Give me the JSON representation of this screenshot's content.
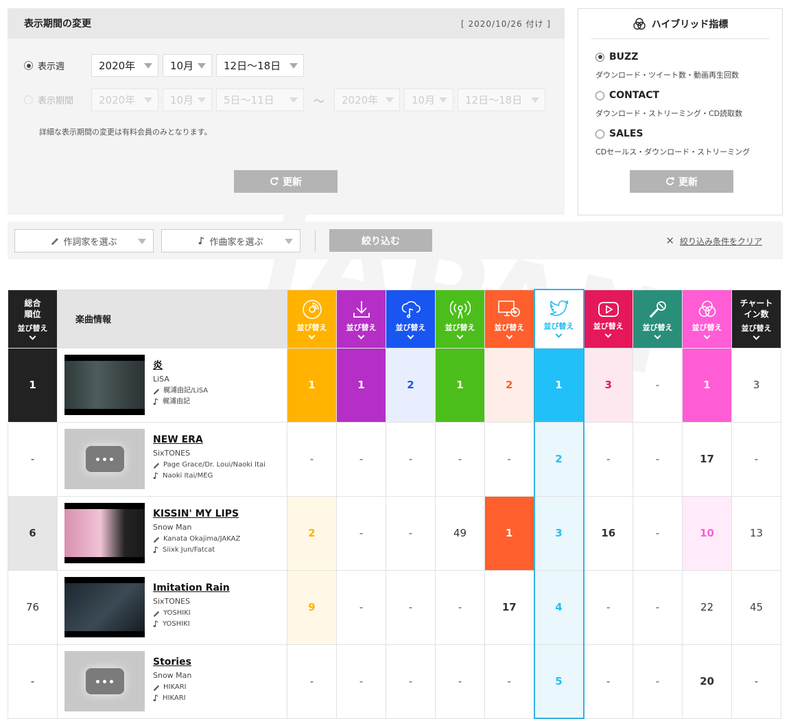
{
  "period": {
    "title": "表示期間の変更",
    "date": "[ 2020/10/26 付け ]",
    "week_label": "表示週",
    "range_label": "表示期間",
    "week": {
      "year": "2020年",
      "month": "10月",
      "range": "12日〜18日"
    },
    "range_from": {
      "year": "2020年",
      "month": "10月",
      "range": "5日〜11日"
    },
    "tilde": "〜",
    "range_to": {
      "year": "2020年",
      "month": "10月",
      "range": "12日〜18日"
    },
    "note": "詳細な表示期間の変更は有料会員のみとなります。",
    "update_label": "更新"
  },
  "hybrid": {
    "title": "ハイブリッド指標",
    "options": [
      {
        "label": "BUZZ",
        "desc": "ダウンロード・ツイート数・動画再生回数",
        "selected": true
      },
      {
        "label": "CONTACT",
        "desc": "ダウンロード・ストリーミング・CD読取数",
        "selected": false
      },
      {
        "label": "SALES",
        "desc": "CDセールス・ダウンロード・ストリーミング",
        "selected": false
      }
    ],
    "update_label": "更新"
  },
  "filter": {
    "lyricist_label": "作詞家を選ぶ",
    "composer_label": "作曲家を選ぶ",
    "apply_label": "絞り込む",
    "clear_label": "絞り込み条件をクリア"
  },
  "watermark": "JAPAN",
  "table": {
    "rank_header": "総合\n順位",
    "info_header": "楽曲情報",
    "sort_label": "並び替え",
    "chartin_header": "チャート\nイン数",
    "metric_icons": [
      "cd-icon",
      "download-icon",
      "streaming-icon",
      "radio-icon",
      "pc-icon",
      "twitter-icon",
      "youtube-icon",
      "karaoke-icon",
      "hybrid-icon"
    ],
    "colors": {
      "cd": "#FFB300",
      "download": "#B52FC6",
      "streaming": "#1955F0",
      "radio": "#4CBE1C",
      "pc": "#FF5F2D",
      "twitter": "#22B9F0",
      "youtube": "#E4185A",
      "karaoke": "#2A8F7A",
      "hybrid": "#FF5CD6"
    },
    "rows": [
      {
        "rank": "1",
        "title": "炎",
        "artist": "LiSA",
        "lyricist": "梶浦由記/LiSA",
        "composer": "梶浦由記",
        "thumb": "video",
        "values": [
          "1",
          "1",
          "2",
          "1",
          "2",
          "1",
          "3",
          "-",
          "1"
        ],
        "chartin": "3"
      },
      {
        "rank": "-",
        "title": "NEW ERA",
        "artist": "SixTONES",
        "lyricist": "Page Grace/Dr. Loui/Naoki Itai",
        "composer": "Naoki Itai/MEG",
        "thumb": "placeholder",
        "values": [
          "-",
          "-",
          "-",
          "-",
          "-",
          "2",
          "-",
          "-",
          "17"
        ],
        "chartin": "-"
      },
      {
        "rank": "6",
        "title": "KISSIN' MY LIPS",
        "artist": "Snow Man",
        "lyricist": "Kanata Okajima/JAKAZ",
        "composer": "Siixk Jun/Fatcat",
        "thumb": "video",
        "values": [
          "2",
          "-",
          "-",
          "49",
          "1",
          "3",
          "16",
          "-",
          "10"
        ],
        "chartin": "13"
      },
      {
        "rank": "76",
        "title": "Imitation Rain",
        "artist": "SixTONES",
        "lyricist": "YOSHIKI",
        "composer": "YOSHIKI",
        "thumb": "video",
        "values": [
          "9",
          "-",
          "-",
          "-",
          "17",
          "4",
          "-",
          "-",
          "22"
        ],
        "chartin": "45"
      },
      {
        "rank": "-",
        "title": "Stories",
        "artist": "Snow Man",
        "lyricist": "HIKARI",
        "composer": "HIKARI",
        "thumb": "placeholder",
        "values": [
          "-",
          "-",
          "-",
          "-",
          "-",
          "5",
          "-",
          "-",
          "20"
        ],
        "chartin": "-"
      }
    ]
  }
}
